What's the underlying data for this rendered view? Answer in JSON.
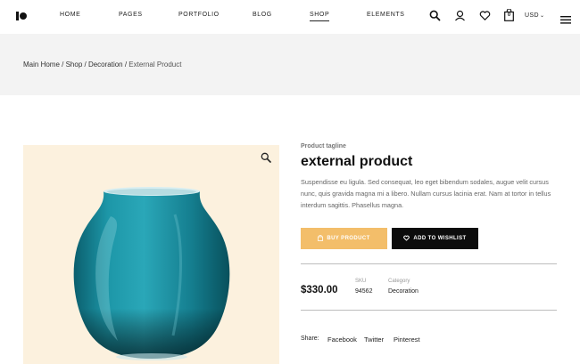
{
  "header": {
    "nav": [
      "HOME",
      "PAGES",
      "PORTFOLIO",
      "BLOG",
      "SHOP",
      "ELEMENTS"
    ],
    "active_nav": "SHOP",
    "currency": "USD",
    "cart_count": "0",
    "icons": [
      "search-icon",
      "user-icon",
      "heart-icon",
      "cart-icon",
      "menu-icon"
    ]
  },
  "breadcrumb": {
    "items": [
      "Main Home",
      "Shop",
      "Decoration"
    ],
    "separator": " / ",
    "current": "External Product"
  },
  "product": {
    "tagline": "Product tagline",
    "title": "external product",
    "description": "Suspendisse eu ligula. Sed consequat, leo eget bibendum sodales, augue velit cursus nunc, quis gravida magna mi a libero. Nullam cursus lacinia erat. Nam at tortor in tellus interdum sagittis. Phasellus magna.",
    "buy_label": "BUY PRODUCT",
    "wishlist_label": "ADD TO WISHLIST",
    "price": "$330.00",
    "sku_label": "SKU",
    "sku_value": "94562",
    "category_label": "Category",
    "category_value": "Decoration",
    "share_label": "Share:",
    "share_links": [
      "Facebook",
      "Twitter",
      "Pinterest"
    ]
  },
  "colors": {
    "buy_button": "#f3be6a",
    "wishlist_button": "#0c0c0c",
    "image_background": "#fcf1de",
    "breadcrumb_band": "#f3f3f3",
    "vase": "#1a8f9e"
  }
}
